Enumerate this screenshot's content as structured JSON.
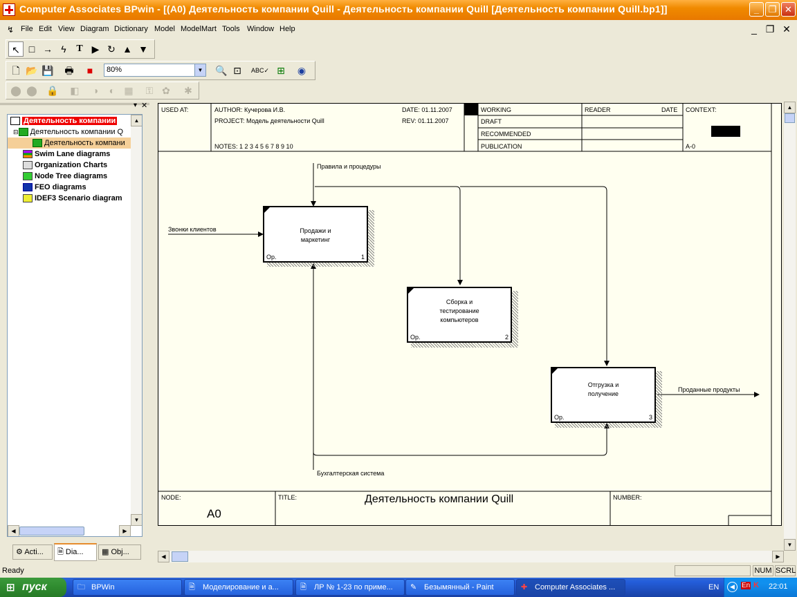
{
  "window": {
    "title": "Computer Associates BPwin - [(A0) Деятельность компании Quill - Деятельность компании Quill  [Деятельность компании Quill.bp1]]"
  },
  "menu": [
    "File",
    "Edit",
    "View",
    "Diagram",
    "Dictionary",
    "Model",
    "ModelMart",
    "Tools",
    "Window",
    "Help"
  ],
  "zoom": "80%",
  "tree": {
    "root": "Деятельность компании",
    "child": "Деятельность компании Q",
    "subchild": "Деятельность компани",
    "items": [
      "Swim Lane diagrams",
      "Organization Charts",
      "Node Tree diagrams",
      "FEO diagrams",
      "IDEF3 Scenario diagram"
    ]
  },
  "panel_tabs": [
    "Acti...",
    "Dia...",
    "Obj..."
  ],
  "frame": {
    "used_at": "USED AT:",
    "author": "AUTHOR:  Кучерова И.В.",
    "project": "PROJECT:  Модель деятельности Quill",
    "date": "DATE:  01.11.2007",
    "rev": "REV:    01.11.2007",
    "notes": "NOTES:  1  2  3  4  5  6  7  8  9  10",
    "working": "WORKING",
    "draft": "DRAFT",
    "recommended": "RECOMMENDED",
    "publication": "PUBLICATION",
    "reader": "READER",
    "reader_date": "DATE",
    "context": "CONTEXT:",
    "context_node": "A-0",
    "node_label": "NODE:",
    "node_value": "A0",
    "title_label": "TITLE:",
    "title_value": "Деятельность компании Quill",
    "number_label": "NUMBER:"
  },
  "boxes": [
    {
      "label1": "Продажи и",
      "label2": "маркетинг",
      "label3": "",
      "op": "Op.",
      "num": "1"
    },
    {
      "label1": "Сборка и",
      "label2": "тестирование",
      "label3": "компьютеров",
      "op": "Op.",
      "num": "2"
    },
    {
      "label1": "Отгрузка и",
      "label2": "получение",
      "label3": "",
      "op": "Op.",
      "num": "3"
    }
  ],
  "arrows": {
    "control": "Правила и процедуры",
    "input": "Звонки клиентов",
    "output": "Проданные продукты",
    "mechanism": "Бухгалтерская система"
  },
  "status": {
    "left": "Ready",
    "num": "NUM",
    "scrl": "SCRL"
  },
  "taskbar": {
    "start": "пуск",
    "tasks": [
      "BPWin",
      "Моделирование и а...",
      "ЛР № 1-23 по приме...",
      "Безымянный - Paint",
      "Computer Associates ..."
    ],
    "lang": "EN",
    "time": "22:01"
  }
}
